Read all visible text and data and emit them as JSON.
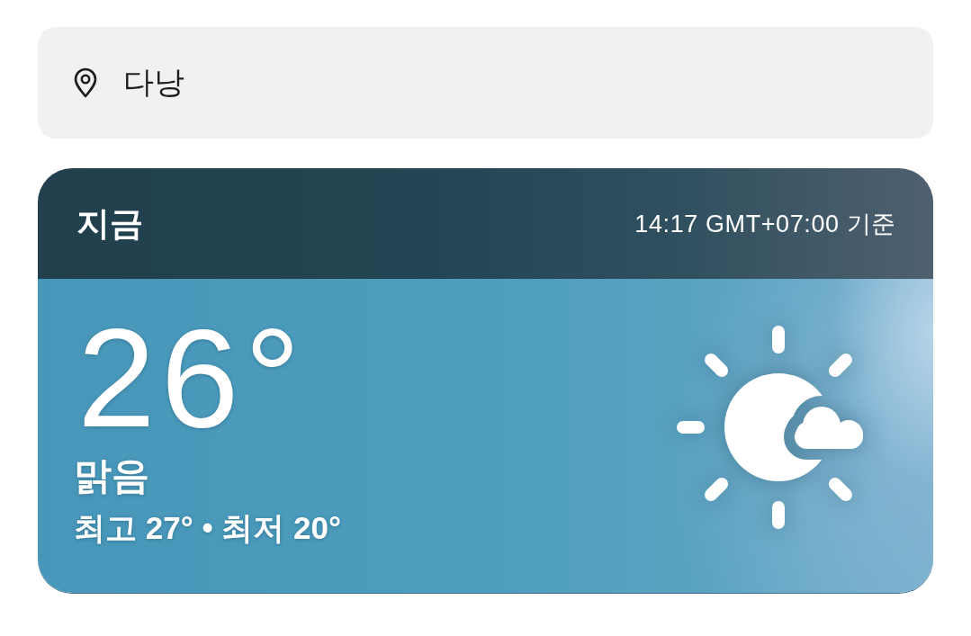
{
  "location": {
    "name": "다낭"
  },
  "current": {
    "title": "지금",
    "timestamp": "14:17 GMT+07:00 기준",
    "temperature": "26°",
    "condition": "맑음",
    "high_low": "최고 27° • 최저 20°"
  }
}
